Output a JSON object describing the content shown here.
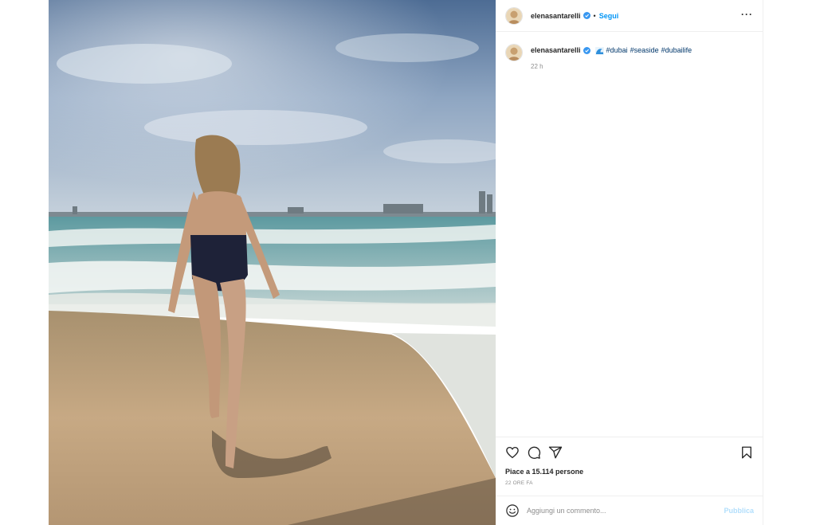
{
  "post": {
    "username": "elenasantarelli",
    "separator": "•",
    "follow_label": "Segui",
    "more_label": "···",
    "caption": {
      "username": "elenasantarelli",
      "emoji": "wave-emoji",
      "hashtags": [
        "#dubai",
        "#seaside",
        "#dubailife"
      ],
      "time": "22 h"
    },
    "likes": "Piace a 15.114 persone",
    "time_ago": "22 ORE FA",
    "comment_placeholder": "Aggiungi un commento...",
    "publish_label": "Pubblica"
  },
  "icons": {
    "verified": "verified-badge-icon",
    "like": "heart-icon",
    "comment": "comment-icon",
    "share": "share-icon",
    "save": "bookmark-icon",
    "emoji": "smiley-icon"
  },
  "colors": {
    "link": "#0095f6",
    "hashtag": "#00376b",
    "muted": "#8e8e8e",
    "publish_disabled": "#b2dffc"
  }
}
